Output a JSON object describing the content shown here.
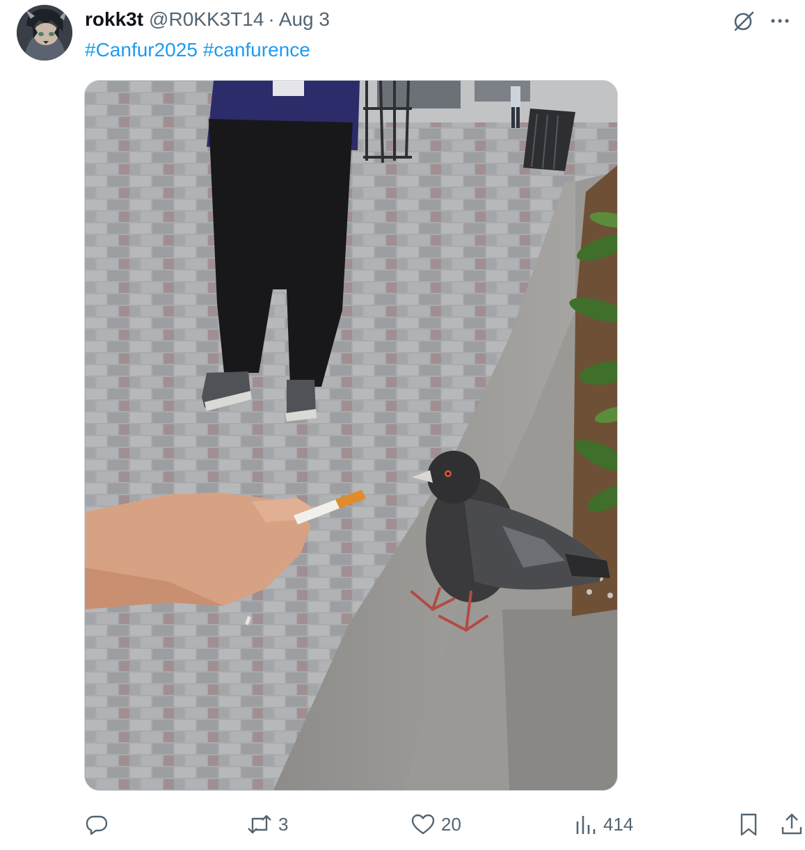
{
  "author": {
    "display_name": "rokk3t",
    "handle": "@R0KK3T14",
    "separator": "·",
    "time": "Aug 3"
  },
  "text": {
    "hashtags": [
      "#Canfur2025",
      "#canfurence"
    ]
  },
  "actions": {
    "reply_count": "",
    "repost_count": "3",
    "like_count": "20",
    "view_count": "414"
  },
  "icons": {
    "grok": "grok-icon",
    "more": "more-icon",
    "reply": "reply-icon",
    "repost": "repost-icon",
    "like": "heart-icon",
    "views": "analytics-icon",
    "bookmark": "bookmark-icon",
    "share": "share-icon"
  },
  "colors": {
    "link": "#1d9bf0",
    "muted": "#536471",
    "text": "#0f1419"
  }
}
